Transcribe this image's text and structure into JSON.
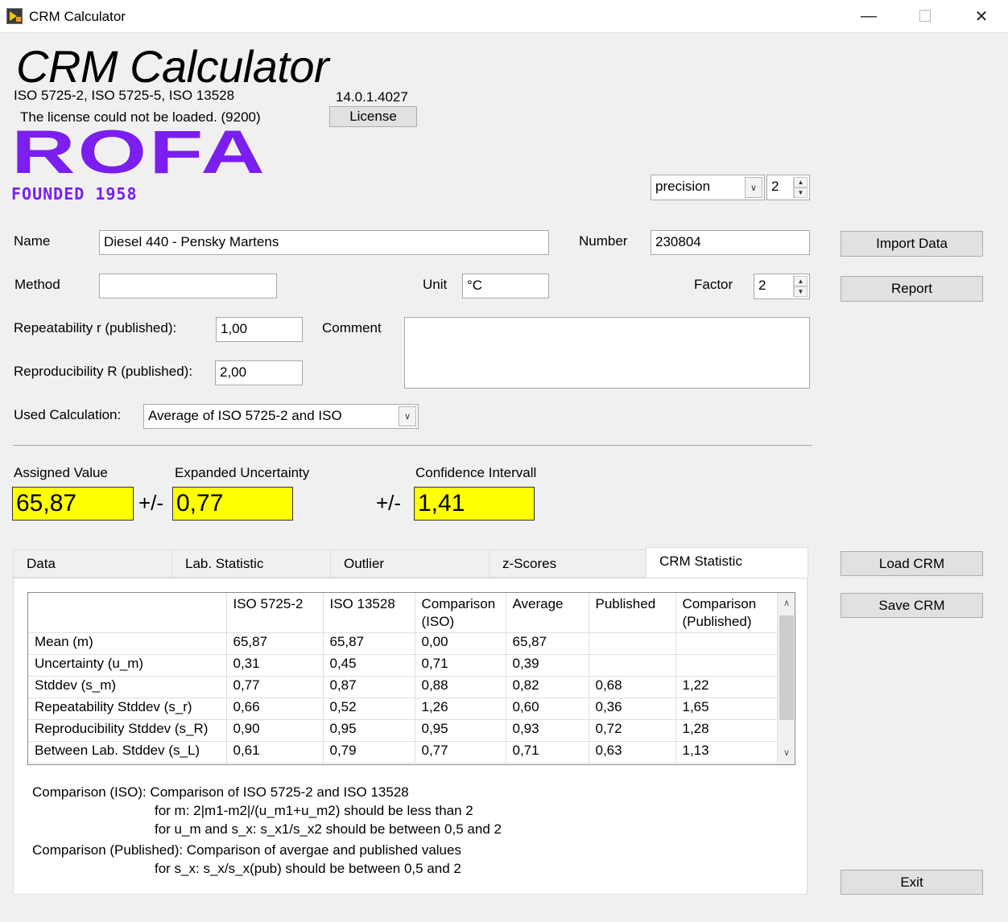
{
  "window": {
    "title": "CRM Calculator",
    "minimize": "—",
    "maximize": "☐",
    "close": "✕"
  },
  "header": {
    "title": "CRM Calculator",
    "standards": "ISO 5725-2, ISO 5725-5, ISO 13528",
    "version": "14.0.1.4027",
    "license_msg": "The license could not be loaded. (9200)",
    "license_button": "License",
    "logo_text": "ROFA",
    "logo_sub": "FOUNDED 1958"
  },
  "precision": {
    "label": "precision",
    "value": "2"
  },
  "form": {
    "name_label": "Name",
    "name_value": "Diesel 440 - Pensky Martens",
    "number_label": "Number",
    "number_value": "230804",
    "method_label": "Method",
    "method_value": "",
    "unit_label": "Unit",
    "unit_value": "°C",
    "factor_label": "Factor",
    "factor_value": "2",
    "repeat_label": "Repeatability r (published):",
    "repeat_value": "1,00",
    "comment_label": "Comment",
    "comment_value": "",
    "reprod_label": "Reproducibility R (published):",
    "reprod_value": "2,00",
    "calc_label": "Used Calculation:",
    "calc_value": "Average of ISO 5725-2 and ISO"
  },
  "buttons": {
    "import": "Import Data",
    "report": "Report",
    "load": "Load CRM",
    "save": "Save CRM",
    "exit": "Exit"
  },
  "results": {
    "assigned_label": "Assigned Value",
    "assigned_value": "65,87",
    "pm1": "+/-",
    "expanded_label": "Expanded Uncertainty",
    "expanded_value": "0,77",
    "pm2": "+/-",
    "confidence_label": "Confidence Intervall",
    "confidence_value": "1,41"
  },
  "tabs": [
    "Data",
    "Lab. Statistic",
    "Outlier",
    "z-Scores",
    "CRM Statistic"
  ],
  "table": {
    "headers": [
      "",
      "ISO 5725-2",
      "ISO 13528",
      "Comparison (ISO)",
      "Average",
      "Published",
      "Comparison (Published)"
    ],
    "rows": [
      [
        "Mean (m)",
        "65,87",
        "65,87",
        "0,00",
        "65,87",
        "",
        ""
      ],
      [
        "Uncertainty (u_m)",
        "0,31",
        "0,45",
        "0,71",
        "0,39",
        "",
        ""
      ],
      [
        "Stddev (s_m)",
        "0,77",
        "0,87",
        "0,88",
        "0,82",
        "0,68",
        "1,22"
      ],
      [
        "Repeatability Stddev (s_r)",
        "0,66",
        "0,52",
        "1,26",
        "0,60",
        "0,36",
        "1,65"
      ],
      [
        "Reproducibility Stddev (s_R)",
        "0,90",
        "0,95",
        "0,95",
        "0,93",
        "0,72",
        "1,28"
      ],
      [
        "Between Lab. Stddev (s_L)",
        "0,61",
        "0,79",
        "0,77",
        "0,71",
        "0,63",
        "1,13"
      ]
    ]
  },
  "notes": [
    "Comparison (ISO): Comparison of ISO 5725-2 and ISO 13528",
    "for m: 2|m1-m2|/(u_m1+u_m2) should be less than 2",
    "for u_m and s_x: s_x1/s_x2 should be between 0,5 and 2",
    "Comparison (Published): Comparison of avergae and published values",
    "for s_x: s_x/s_x(pub) should be between 0,5 and 2"
  ]
}
